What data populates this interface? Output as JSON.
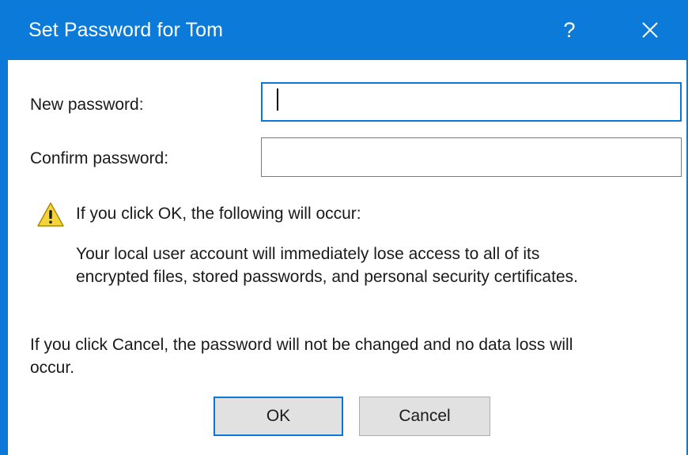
{
  "dialog": {
    "title": "Set Password for Tom",
    "help_label": "?",
    "close_icon": "close-icon",
    "accent_color": "#0b7ad9"
  },
  "form": {
    "new_password_label": "New password:",
    "new_password_value": "",
    "confirm_password_label": "Confirm password:",
    "confirm_password_value": ""
  },
  "warning": {
    "icon": "warning-icon",
    "heading": "If you click OK, the following will occur:",
    "body_line1": "Your local user account will immediately lose access to all of its",
    "body_line2": "encrypted files, stored passwords, and personal security certificates."
  },
  "cancel_note": {
    "line1": "If you click Cancel, the password will not be changed and no data loss will",
    "line2": "occur."
  },
  "buttons": {
    "ok_label": "OK",
    "cancel_label": "Cancel"
  }
}
